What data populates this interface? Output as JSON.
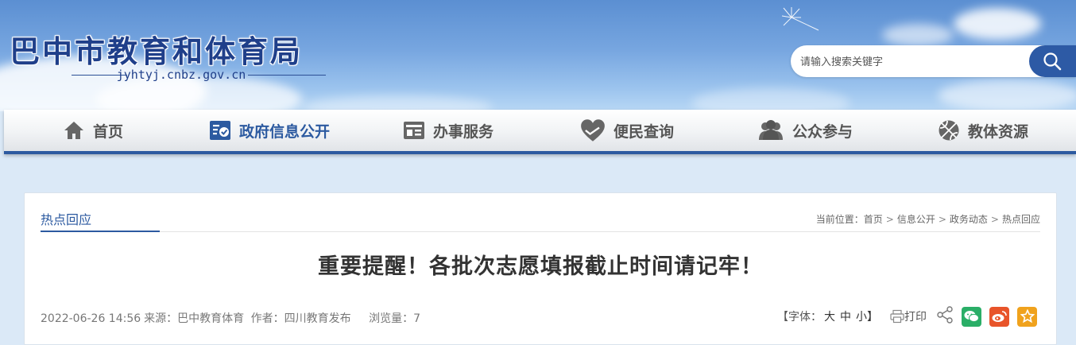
{
  "header": {
    "site_title": "巴中市教育和体育局",
    "domain": "jyhtyj.cnbz.gov.cn",
    "search_placeholder": "请输入搜索关键字",
    "search_icon": "search-icon"
  },
  "nav": {
    "items": [
      {
        "label": "首页",
        "icon": "home-icon"
      },
      {
        "label": "政府信息公开",
        "icon": "info-check-icon",
        "active": true
      },
      {
        "label": "办事服务",
        "icon": "id-card-icon"
      },
      {
        "label": "便民查询",
        "icon": "heart-hands-icon"
      },
      {
        "label": "公众参与",
        "icon": "people-icon"
      },
      {
        "label": "教体资源",
        "icon": "basketball-icon"
      }
    ]
  },
  "section": {
    "tab_label": "热点回应",
    "breadcrumb": {
      "prefix": "当前位置：",
      "items": [
        "首页",
        "信息公开",
        "政务动态",
        "热点回应"
      ],
      "separator": ">"
    }
  },
  "article": {
    "title": "重要提醒！各批次志愿填报截止时间请记牢！",
    "date": "2022-06-26 14:56",
    "source": "来源：巴中教育体育",
    "author": "作者：四川教育发布",
    "views": "浏览量：7"
  },
  "tools": {
    "font_prefix": "【字体：",
    "font_large": "大",
    "font_medium": "中",
    "font_small": "小】",
    "print_label": "打印",
    "share_icon": "share-icon",
    "social": [
      "wechat-icon",
      "weibo-icon",
      "favorite-icon"
    ]
  },
  "colors": {
    "brand_blue": "#2c5aa0",
    "title_blue": "#1f3f8a",
    "wechat_green": "#2aae67",
    "weibo_orange": "#e8542a",
    "fav_yellow": "#f0a21d"
  }
}
